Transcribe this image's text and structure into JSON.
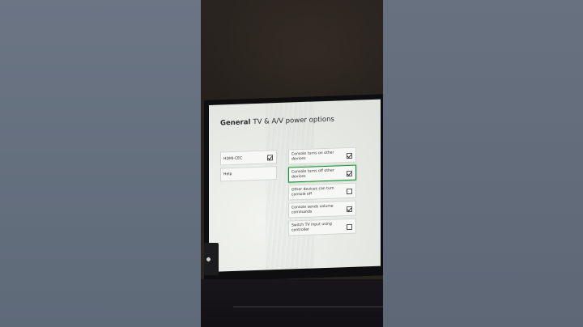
{
  "screen": {
    "section_title": "General",
    "page_title": "TV & A/V power options",
    "left_column": [
      {
        "label": "HDMI-CEC",
        "checked": true
      },
      {
        "label": "Help",
        "checked": null
      }
    ],
    "right_column": [
      {
        "label": "Console turns on other devices",
        "checked": true,
        "focused": false
      },
      {
        "label": "Console turns off other devices",
        "checked": true,
        "focused": true
      },
      {
        "label": "Other devices can turn console off",
        "checked": false,
        "focused": false
      },
      {
        "label": "Console sends volume commands",
        "checked": true,
        "focused": false
      },
      {
        "label": "Switch TV input using controller",
        "checked": false,
        "focused": false
      }
    ]
  },
  "colors": {
    "focus_outline": "#1f8a3a",
    "screen_bg": "#e9ebe6"
  }
}
